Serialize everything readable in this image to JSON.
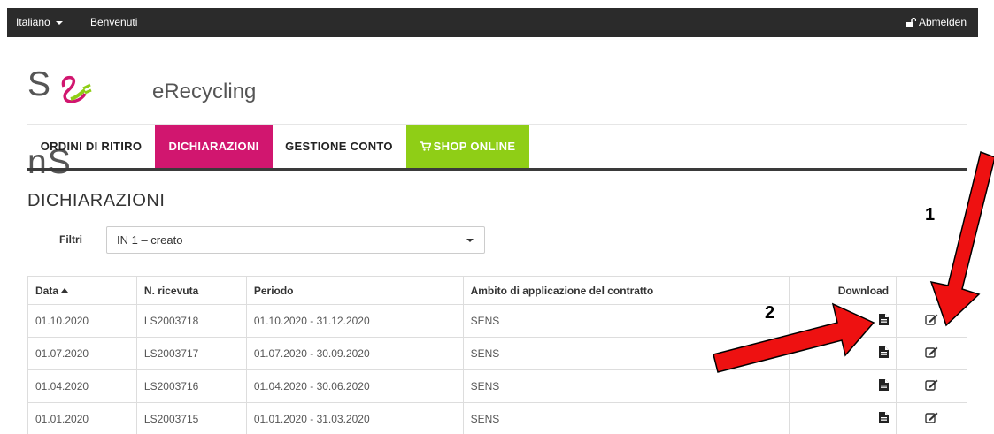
{
  "topbar": {
    "language": "Italiano",
    "welcome": "Benvenuti",
    "logout": "Abmelden"
  },
  "logo": {
    "brand": "SENS",
    "sub": "eRecycling"
  },
  "nav": {
    "items": [
      {
        "label": "ORDINI DI RITIRO"
      },
      {
        "label": "DICHIARAZIONI",
        "active": true
      },
      {
        "label": "GESTIONE CONTO"
      },
      {
        "label": "SHOP ONLINE",
        "icon": "cart-icon"
      }
    ]
  },
  "heading": "DICHIARAZIONI",
  "filter": {
    "label": "Filtri",
    "value": "IN 1 – creato"
  },
  "table": {
    "headers": [
      "Data",
      "N. ricevuta",
      "Periodo",
      "Ambito di applicazione del contratto",
      "Download",
      ""
    ],
    "rows": [
      [
        "01.10.2020",
        "LS2003718",
        "01.10.2020 - 31.12.2020",
        "SENS"
      ],
      [
        "01.07.2020",
        "LS2003717",
        "01.07.2020 - 30.09.2020",
        "SENS"
      ],
      [
        "01.04.2020",
        "LS2003716",
        "01.04.2020 - 30.06.2020",
        "SENS"
      ],
      [
        "01.01.2020",
        "LS2003715",
        "01.01.2020 - 31.03.2020",
        "SENS"
      ]
    ]
  },
  "annotations": {
    "one": "1",
    "two": "2"
  },
  "colors": {
    "accent_magenta": "#d1166f",
    "accent_green": "#8fce16",
    "arrow_red": "#ee1111",
    "topbar": "#2b2b2b"
  }
}
